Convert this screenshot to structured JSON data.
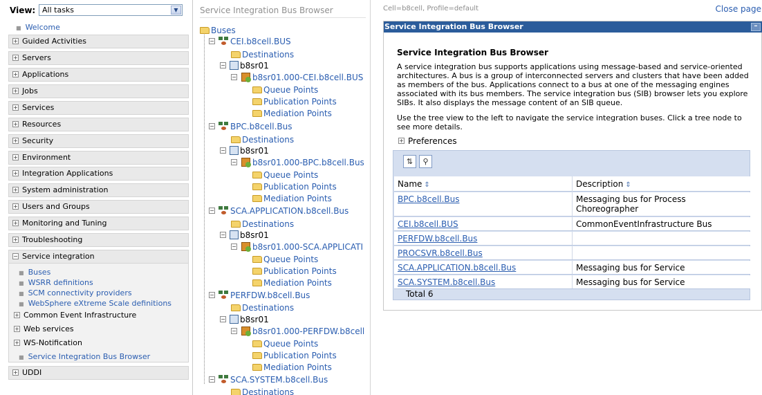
{
  "left_nav": {
    "view_label": "View:",
    "view_value": "All tasks",
    "welcome": "Welcome",
    "categories": [
      {
        "label": "Guided Activities"
      },
      {
        "label": "Servers"
      },
      {
        "label": "Applications"
      },
      {
        "label": "Jobs"
      },
      {
        "label": "Services"
      },
      {
        "label": "Resources"
      },
      {
        "label": "Security"
      },
      {
        "label": "Environment"
      },
      {
        "label": "Integration Applications"
      },
      {
        "label": "System administration"
      },
      {
        "label": "Users and Groups"
      },
      {
        "label": "Monitoring and Tuning"
      },
      {
        "label": "Troubleshooting"
      },
      {
        "label": "Service integration"
      },
      {
        "label": "UDDI"
      }
    ],
    "service_integration_items": [
      {
        "label": "Buses"
      },
      {
        "label": "WSRR definitions"
      },
      {
        "label": "SCM connectivity providers"
      },
      {
        "label": "WebSphere eXtreme Scale definitions"
      },
      {
        "label": "Common Event Infrastructure"
      },
      {
        "label": "Web services"
      },
      {
        "label": "WS-Notification"
      },
      {
        "label": "Service Integration Bus Browser"
      }
    ]
  },
  "tree": {
    "title": "Service Integration Bus Browser",
    "root": "Buses",
    "buses": [
      {
        "name": "CEI.b8cell.BUS",
        "destinations": "Destinations",
        "server": "b8sr01",
        "engine": "b8sr01.000-CEI.b8cell.BUS",
        "points": [
          "Queue Points",
          "Publication Points",
          "Mediation Points"
        ]
      },
      {
        "name": "BPC.b8cell.Bus",
        "destinations": "Destinations",
        "server": "b8sr01",
        "engine": "b8sr01.000-BPC.b8cell.Bus",
        "points": [
          "Queue Points",
          "Publication Points",
          "Mediation Points"
        ]
      },
      {
        "name": "SCA.APPLICATION.b8cell.Bus",
        "destinations": "Destinations",
        "server": "b8sr01",
        "engine": "b8sr01.000-SCA.APPLICATI",
        "points": [
          "Queue Points",
          "Publication Points",
          "Mediation Points"
        ]
      },
      {
        "name": "PERFDW.b8cell.Bus",
        "destinations": "Destinations",
        "server": "b8sr01",
        "engine": "b8sr01.000-PERFDW.b8cell",
        "points": [
          "Queue Points",
          "Publication Points",
          "Mediation Points"
        ]
      },
      {
        "name": "SCA.SYSTEM.b8cell.Bus",
        "destinations": "Destinations"
      }
    ]
  },
  "content": {
    "cell_info": "Cell=b8cell, Profile=default",
    "close_page": "Close page",
    "portlet_title": "Service Integration Bus Browser",
    "minimize": "–",
    "heading": "Service Integration Bus Browser",
    "description": "A service integration bus supports applications using message-based and service-oriented architectures. A bus is a group of interconnected servers and clusters that have been added as members of the bus. Applications connect to a bus at one of the messaging engines associated with its bus members. The service integration bus (SIB) browser lets you explore SIBs. It also displays the message content of an SIB queue.",
    "hint": "Use the tree view to the left to navigate the service integration buses. Click a tree node to see more details.",
    "preferences": "Preferences",
    "table": {
      "col_name": "Name",
      "col_desc": "Description",
      "rows": [
        {
          "name": "BPC.b8cell.Bus",
          "desc": "Messaging bus for Process Choreographer"
        },
        {
          "name": "CEI.b8cell.BUS",
          "desc": "CommonEventInfrastructure Bus"
        },
        {
          "name": "PERFDW.b8cell.Bus",
          "desc": ""
        },
        {
          "name": "PROCSVR.b8cell.Bus",
          "desc": ""
        },
        {
          "name": "SCA.APPLICATION.b8cell.Bus",
          "desc": "Messaging bus for Service"
        },
        {
          "name": "SCA.SYSTEM.b8cell.Bus",
          "desc": "Messaging bus for Service"
        }
      ],
      "total": "Total 6"
    }
  }
}
